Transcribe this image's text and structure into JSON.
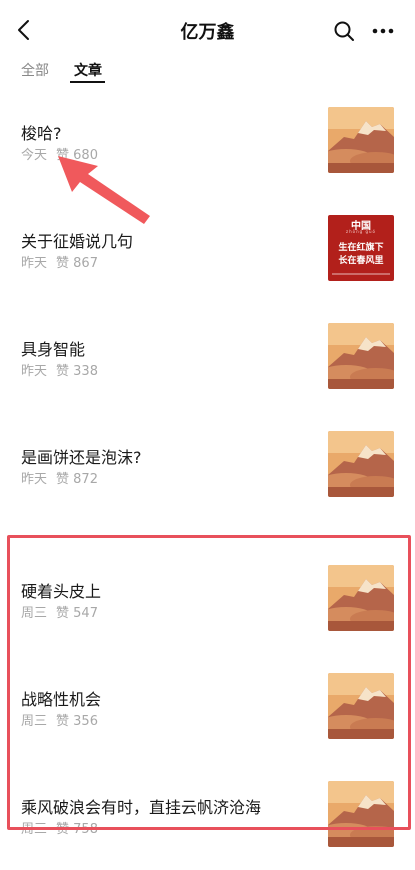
{
  "header": {
    "title": "亿万鑫"
  },
  "tabs": [
    {
      "label": "全部"
    },
    {
      "label": "文章"
    }
  ],
  "articles": [
    {
      "title": "梭哈?",
      "day": "今天",
      "likes": "赞 680",
      "thumb": "mountain"
    },
    {
      "title": "关于征婚说几句",
      "day": "昨天",
      "likes": "赞 867",
      "thumb": "poster"
    },
    {
      "title": "具身智能",
      "day": "昨天",
      "likes": "赞 338",
      "thumb": "mountain"
    },
    {
      "title": "是画饼还是泡沫?",
      "day": "昨天",
      "likes": "赞 872",
      "thumb": "mountain"
    },
    {
      "title": "硬着头皮上",
      "day": "周三",
      "likes": "赞 547",
      "thumb": "mountain"
    },
    {
      "title": "战略性机会",
      "day": "周三",
      "likes": "赞 356",
      "thumb": "mountain"
    },
    {
      "title": "乘风破浪会有时，直挂云帆济沧海",
      "day": "周三",
      "likes": "赞 758",
      "thumb": "mountain"
    }
  ],
  "poster": {
    "headline": "中国",
    "pinyin": "zhōng  guó",
    "line1": "生在红旗下",
    "line2": "长在春风里"
  },
  "colors": {
    "highlight": "#e8505b",
    "poster_red": "#b2201b",
    "meta_gray": "#a8a8a8"
  },
  "icons": {
    "back": "chevron-left-icon",
    "search": "search-icon",
    "more": "more-dots-icon"
  }
}
